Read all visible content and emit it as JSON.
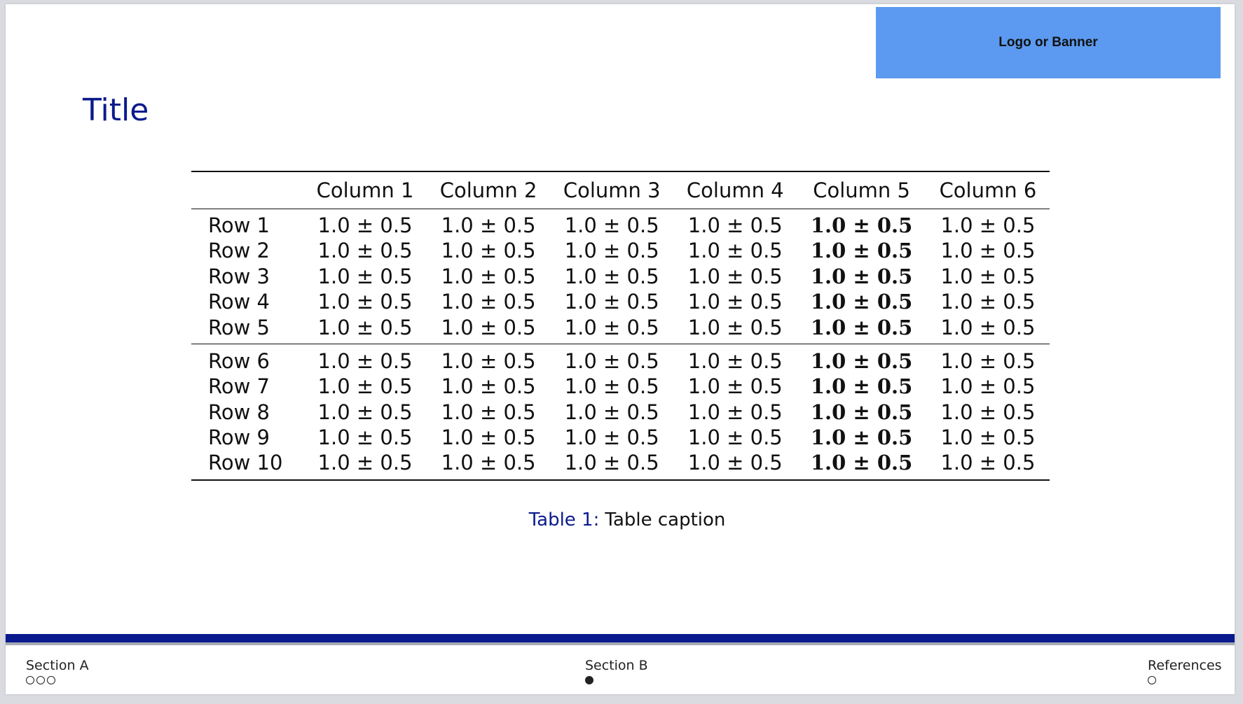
{
  "colors": {
    "title": "#0b1a8c",
    "caption_label": "#0b1a8c",
    "logo_bg": "#5b9af0",
    "footer_bar": "#0a1a8e"
  },
  "logo": {
    "text": "Logo or Banner"
  },
  "title": "Title",
  "table": {
    "header": [
      "",
      "Column 1",
      "Column 2",
      "Column 3",
      "Column 4",
      "Column 5",
      "Column 6"
    ],
    "bold_column_index": 5,
    "group1": [
      [
        "Row 1",
        "1.0 ± 0.5",
        "1.0 ± 0.5",
        "1.0 ± 0.5",
        "1.0 ± 0.5",
        "1.0 ± 0.5",
        "1.0 ± 0.5"
      ],
      [
        "Row 2",
        "1.0 ± 0.5",
        "1.0 ± 0.5",
        "1.0 ± 0.5",
        "1.0 ± 0.5",
        "1.0 ± 0.5",
        "1.0 ± 0.5"
      ],
      [
        "Row 3",
        "1.0 ± 0.5",
        "1.0 ± 0.5",
        "1.0 ± 0.5",
        "1.0 ± 0.5",
        "1.0 ± 0.5",
        "1.0 ± 0.5"
      ],
      [
        "Row 4",
        "1.0 ± 0.5",
        "1.0 ± 0.5",
        "1.0 ± 0.5",
        "1.0 ± 0.5",
        "1.0 ± 0.5",
        "1.0 ± 0.5"
      ],
      [
        "Row 5",
        "1.0 ± 0.5",
        "1.0 ± 0.5",
        "1.0 ± 0.5",
        "1.0 ± 0.5",
        "1.0 ± 0.5",
        "1.0 ± 0.5"
      ]
    ],
    "group2": [
      [
        "Row 6",
        "1.0 ± 0.5",
        "1.0 ± 0.5",
        "1.0 ± 0.5",
        "1.0 ± 0.5",
        "1.0 ± 0.5",
        "1.0 ± 0.5"
      ],
      [
        "Row 7",
        "1.0 ± 0.5",
        "1.0 ± 0.5",
        "1.0 ± 0.5",
        "1.0 ± 0.5",
        "1.0 ± 0.5",
        "1.0 ± 0.5"
      ],
      [
        "Row 8",
        "1.0 ± 0.5",
        "1.0 ± 0.5",
        "1.0 ± 0.5",
        "1.0 ± 0.5",
        "1.0 ± 0.5",
        "1.0 ± 0.5"
      ],
      [
        "Row 9",
        "1.0 ± 0.5",
        "1.0 ± 0.5",
        "1.0 ± 0.5",
        "1.0 ± 0.5",
        "1.0 ± 0.5",
        "1.0 ± 0.5"
      ],
      [
        "Row 10",
        "1.0 ± 0.5",
        "1.0 ± 0.5",
        "1.0 ± 0.5",
        "1.0 ± 0.5",
        "1.0 ± 0.5",
        "1.0 ± 0.5"
      ]
    ]
  },
  "caption": {
    "label": "Table 1:",
    "text": "Table caption"
  },
  "footer": {
    "sections": [
      {
        "label": "Section A",
        "dots": [
          false,
          false,
          false
        ]
      },
      {
        "label": "Section B",
        "dots": [
          true
        ]
      },
      {
        "label": "References",
        "dots": [
          false
        ]
      }
    ]
  }
}
